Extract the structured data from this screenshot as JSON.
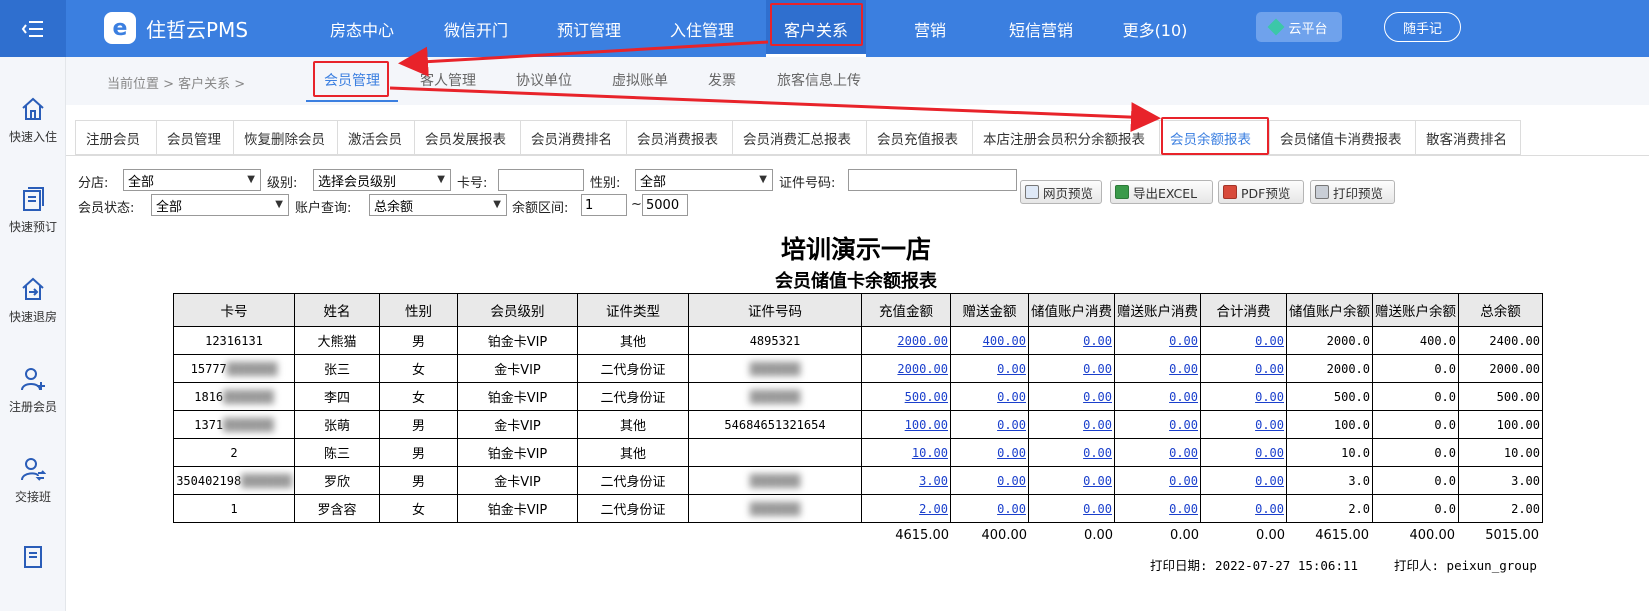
{
  "app": {
    "brand": "住哲云PMS",
    "logo_letter": "e"
  },
  "top_nav": [
    {
      "label": "房态中心",
      "active": false
    },
    {
      "label": "微信开门",
      "active": false
    },
    {
      "label": "预订管理",
      "active": false
    },
    {
      "label": "入住管理",
      "active": false
    },
    {
      "label": "客户关系",
      "active": true
    },
    {
      "label": "营销",
      "active": false
    },
    {
      "label": "短信营销",
      "active": false
    },
    {
      "label": "更多(10)",
      "active": false
    }
  ],
  "top_right": {
    "cloud_label": "云平台",
    "memo_label": "随手记"
  },
  "sidebar": [
    {
      "label": "快速入住",
      "icon": "home-icon"
    },
    {
      "label": "快速预订",
      "icon": "document-icon"
    },
    {
      "label": "快速退房",
      "icon": "checkout-icon"
    },
    {
      "label": "注册会员",
      "icon": "add-user-icon"
    },
    {
      "label": "交接班",
      "icon": "shift-user-icon"
    },
    {
      "label": "",
      "icon": "report-icon"
    }
  ],
  "breadcrumb": {
    "prefix": "当前位置 > 客户关系 >"
  },
  "sub_tabs": [
    {
      "label": "会员管理",
      "active": true
    },
    {
      "label": "客人管理",
      "active": false
    },
    {
      "label": "协议单位",
      "active": false
    },
    {
      "label": "虚拟账单",
      "active": false
    },
    {
      "label": "发票",
      "active": false
    },
    {
      "label": "旅客信息上传",
      "active": false
    }
  ],
  "report_tabs": [
    {
      "label": "注册会员",
      "active": false
    },
    {
      "label": "会员管理",
      "active": false
    },
    {
      "label": "恢复删除会员",
      "active": false
    },
    {
      "label": "激活会员",
      "active": false
    },
    {
      "label": "会员发展报表",
      "active": false
    },
    {
      "label": "会员消费排名",
      "active": false
    },
    {
      "label": "会员消费报表",
      "active": false
    },
    {
      "label": "会员消费汇总报表",
      "active": false
    },
    {
      "label": "会员充值报表",
      "active": false
    },
    {
      "label": "本店注册会员积分余额报表",
      "active": false
    },
    {
      "label": "会员余额报表",
      "active": true
    },
    {
      "label": "会员储值卡消费报表",
      "active": false
    },
    {
      "label": "散客消费排名",
      "active": false
    }
  ],
  "filters": {
    "branch_label": "分店:",
    "branch_value": "全部",
    "level_label": "级别:",
    "level_value": "选择会员级别",
    "card_label": "卡号:",
    "card_value": "",
    "gender_label": "性别:",
    "gender_value": "全部",
    "id_label": "证件号码:",
    "id_value": "",
    "status_label": "会员状态:",
    "status_value": "全部",
    "account_label": "账户查询:",
    "account_value": "总余额",
    "range_label": "余额区间:",
    "range_min": "1",
    "range_sep": "~",
    "range_max": "5000"
  },
  "toolbar": {
    "web_preview": "网页预览",
    "export_excel": "导出EXCEL",
    "pdf_preview": "PDF预览",
    "print_preview": "打印预览"
  },
  "report": {
    "title": "培训演示一店",
    "subtitle": "会员储值卡余额报表",
    "columns": [
      "卡号",
      "姓名",
      "性别",
      "会员级别",
      "证件类型",
      "证件号码",
      "充值金额",
      "赠送金额",
      "储值账户消费",
      "赠送账户消费",
      "合计消费",
      "储值账户余额",
      "赠送账户余额",
      "总余额"
    ],
    "rows": [
      {
        "card": "12316131",
        "name": "大熊猫",
        "gender": "男",
        "level": "铂金卡VIP",
        "id_type": "其他",
        "id_no": "4895321",
        "recharge": "2000.00",
        "gift": "400.00",
        "stored_spend": "0.00",
        "gift_spend": "0.00",
        "total_spend": "0.00",
        "stored_bal": "2000.0",
        "gift_bal": "400.0",
        "total_bal": "2400.00"
      },
      {
        "card": "15777",
        "name": "张三",
        "gender": "女",
        "level": "金卡VIP",
        "id_type": "二代身份证",
        "id_no": "",
        "recharge": "2000.00",
        "gift": "0.00",
        "stored_spend": "0.00",
        "gift_spend": "0.00",
        "total_spend": "0.00",
        "stored_bal": "2000.0",
        "gift_bal": "0.0",
        "total_bal": "2000.00"
      },
      {
        "card": "1816",
        "name": "李四",
        "gender": "女",
        "level": "铂金卡VIP",
        "id_type": "二代身份证",
        "id_no": "",
        "recharge": "500.00",
        "gift": "0.00",
        "stored_spend": "0.00",
        "gift_spend": "0.00",
        "total_spend": "0.00",
        "stored_bal": "500.0",
        "gift_bal": "0.0",
        "total_bal": "500.00"
      },
      {
        "card": "1371",
        "name": "张萌",
        "gender": "男",
        "level": "金卡VIP",
        "id_type": "其他",
        "id_no": "54684651321654",
        "recharge": "100.00",
        "gift": "0.00",
        "stored_spend": "0.00",
        "gift_spend": "0.00",
        "total_spend": "0.00",
        "stored_bal": "100.0",
        "gift_bal": "0.0",
        "total_bal": "100.00"
      },
      {
        "card": "2",
        "name": "陈三",
        "gender": "男",
        "level": "铂金卡VIP",
        "id_type": "其他",
        "id_no": "",
        "recharge": "10.00",
        "gift": "0.00",
        "stored_spend": "0.00",
        "gift_spend": "0.00",
        "total_spend": "0.00",
        "stored_bal": "10.0",
        "gift_bal": "0.0",
        "total_bal": "10.00"
      },
      {
        "card": "350402198",
        "name": "罗欣",
        "gender": "男",
        "level": "金卡VIP",
        "id_type": "二代身份证",
        "id_no": "",
        "recharge": "3.00",
        "gift": "0.00",
        "stored_spend": "0.00",
        "gift_spend": "0.00",
        "total_spend": "0.00",
        "stored_bal": "3.0",
        "gift_bal": "0.0",
        "total_bal": "3.00"
      },
      {
        "card": "1",
        "name": "罗含容",
        "gender": "女",
        "level": "铂金卡VIP",
        "id_type": "二代身份证",
        "id_no": "",
        "recharge": "2.00",
        "gift": "0.00",
        "stored_spend": "0.00",
        "gift_spend": "0.00",
        "total_spend": "0.00",
        "stored_bal": "2.0",
        "gift_bal": "0.0",
        "total_bal": "2.00"
      }
    ],
    "totals": {
      "recharge": "4615.00",
      "gift": "400.00",
      "stored_spend": "0.00",
      "gift_spend": "0.00",
      "total_spend": "0.00",
      "stored_bal": "4615.00",
      "gift_bal": "400.00",
      "total_bal": "5015.00"
    },
    "print_date": "打印日期: 2022-07-27 15:06:11",
    "printer": "打印人: peixun_group"
  },
  "colors": {
    "primary": "#3b7fe0",
    "highlight": "#e8232a",
    "link": "#1a3fcc"
  }
}
